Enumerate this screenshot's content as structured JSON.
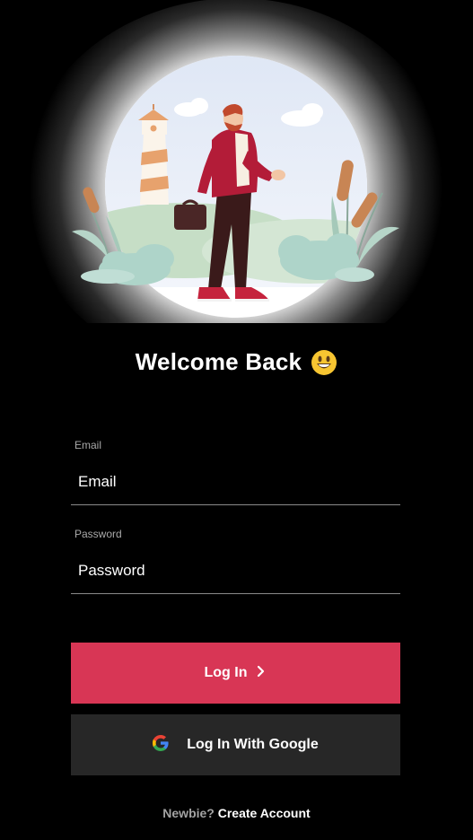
{
  "welcome": {
    "title": "Welcome Back"
  },
  "email": {
    "label": "Email",
    "placeholder": "Email"
  },
  "password": {
    "label": "Password",
    "placeholder": "Password"
  },
  "login_button": {
    "label": "Log In",
    "icon": "chevron-right-icon"
  },
  "google_button": {
    "label": "Log In With Google",
    "icon": "google-icon"
  },
  "footer": {
    "prompt": "Newbie?",
    "link": "Create Account"
  },
  "colors": {
    "background": "#000000",
    "accent": "#d83655",
    "google_button_bg": "#272727",
    "muted_text": "#a3a3a3"
  }
}
